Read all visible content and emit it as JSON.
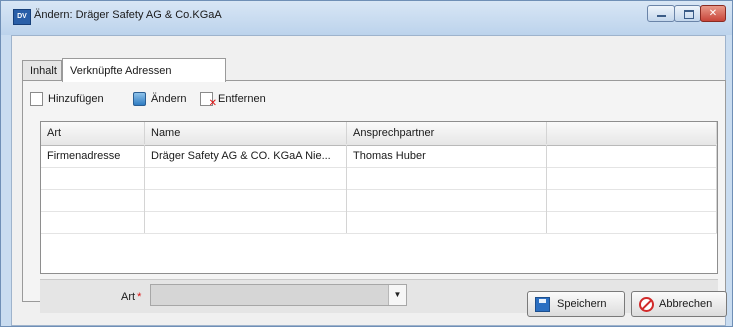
{
  "window": {
    "app_icon": "app-icon",
    "title": "Ändern: Dräger Safety AG & Co.KGaA",
    "minimize_icon": "minimize-icon",
    "maximize_icon": "maximize-icon",
    "close_icon": "close-icon"
  },
  "tabs": [
    {
      "label": "Inhalt"
    },
    {
      "label": "Verknüpfte Adressen"
    }
  ],
  "toolbar": {
    "add_label": "Hinzufügen",
    "edit_label": "Ändern",
    "remove_label": "Entfernen"
  },
  "grid": {
    "columns": [
      "Art",
      "Name",
      "Ansprechpartner",
      ""
    ],
    "rows": [
      [
        "Firmenadresse",
        "Dräger Safety AG & CO. KGaA Nie...",
        "Thomas Huber",
        ""
      ],
      [
        "",
        "",
        "",
        ""
      ],
      [
        "",
        "",
        "",
        ""
      ],
      [
        "",
        "",
        "",
        ""
      ]
    ]
  },
  "filter": {
    "label": "Art",
    "required_marker": "*",
    "value": ""
  },
  "footer": {
    "save_label": "Speichern",
    "cancel_label": "Abbrechen"
  },
  "colors": {
    "title_bar": "#c9dcf0",
    "close_button": "#c8453a",
    "required_marker": "#dd1111",
    "save_icon": "#2b6fc2",
    "cancel_icon": "#d12a2a"
  }
}
